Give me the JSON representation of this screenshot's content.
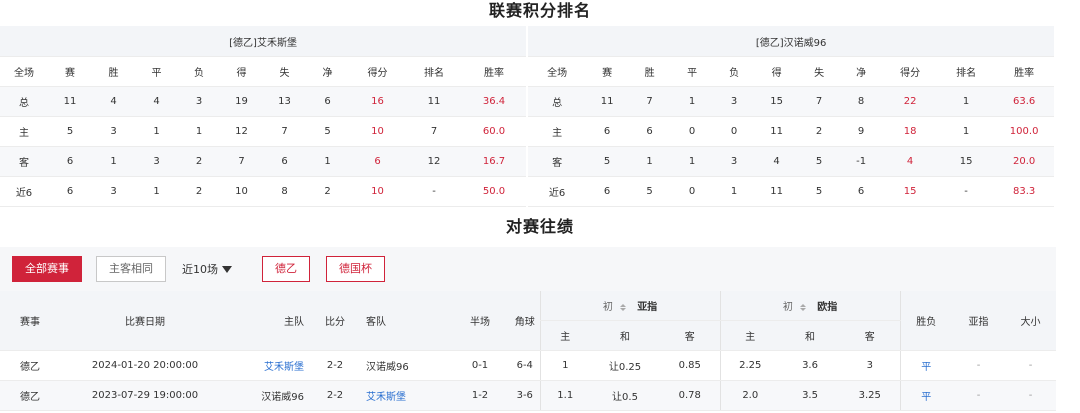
{
  "standings_title": "联赛积分排名",
  "records_title": "对赛往绩",
  "standings_columns": [
    "全场",
    "赛",
    "胜",
    "平",
    "负",
    "得",
    "失",
    "净",
    "得分",
    "排名",
    "胜率"
  ],
  "home_team": {
    "name": "[德乙]艾禾斯堡",
    "rows": [
      [
        "总",
        "11",
        "4",
        "4",
        "3",
        "19",
        "13",
        "6",
        "16",
        "11",
        "36.4"
      ],
      [
        "主",
        "5",
        "3",
        "1",
        "1",
        "12",
        "7",
        "5",
        "10",
        "7",
        "60.0"
      ],
      [
        "客",
        "6",
        "1",
        "3",
        "2",
        "7",
        "6",
        "1",
        "6",
        "12",
        "16.7"
      ],
      [
        "近6",
        "6",
        "3",
        "1",
        "2",
        "10",
        "8",
        "2",
        "10",
        "-",
        "50.0"
      ]
    ]
  },
  "away_team": {
    "name": "[德乙]汉诺威96",
    "rows": [
      [
        "总",
        "11",
        "7",
        "1",
        "3",
        "15",
        "7",
        "8",
        "22",
        "1",
        "63.6"
      ],
      [
        "主",
        "6",
        "6",
        "0",
        "0",
        "11",
        "2",
        "9",
        "18",
        "1",
        "100.0"
      ],
      [
        "客",
        "5",
        "1",
        "1",
        "3",
        "4",
        "5",
        "-1",
        "4",
        "15",
        "20.0"
      ],
      [
        "近6",
        "6",
        "5",
        "0",
        "1",
        "11",
        "5",
        "6",
        "15",
        "-",
        "83.3"
      ]
    ]
  },
  "filters": {
    "all_matches": "全部赛事",
    "same_home_away": "主客相同",
    "recent": "近10场",
    "league": "德乙",
    "cup": "德国杯"
  },
  "records_header": {
    "competition": "赛事",
    "date": "比赛日期",
    "home": "主队",
    "score": "比分",
    "away": "客队",
    "half": "半场",
    "corners": "角球",
    "initial": "初",
    "asian": "亚指",
    "euro": "欧指",
    "result": "胜负",
    "asian_result": "亚指",
    "over_under": "大小",
    "asian_sub": [
      "主",
      "和",
      "客"
    ],
    "euro_sub": [
      "主",
      "和",
      "客"
    ]
  },
  "records": [
    {
      "competition": "德乙",
      "date": "2024-01-20 20:00:00",
      "home": "艾禾斯堡",
      "score": "2-2",
      "away": "汉诺威96",
      "half": "0-1",
      "corners": "6-4",
      "asian_home": "1",
      "asian_line": "让0.25",
      "asian_away": "0.85",
      "euro_home": "2.25",
      "euro_draw": "3.6",
      "euro_away": "3",
      "result": "平",
      "asian_result": "-",
      "over_under": "-"
    },
    {
      "competition": "德乙",
      "date": "2023-07-29 19:00:00",
      "home": "汉诺威96",
      "score": "2-2",
      "away": "艾禾斯堡",
      "half": "1-2",
      "corners": "3-6",
      "asian_home": "1.1",
      "asian_line": "让0.5",
      "asian_away": "0.78",
      "euro_home": "2.0",
      "euro_draw": "3.5",
      "euro_away": "3.25",
      "result": "平",
      "asian_result": "-",
      "over_under": "-"
    }
  ],
  "colors": {
    "accent_red": "#d0233a",
    "link_blue": "#2a6fd0"
  }
}
